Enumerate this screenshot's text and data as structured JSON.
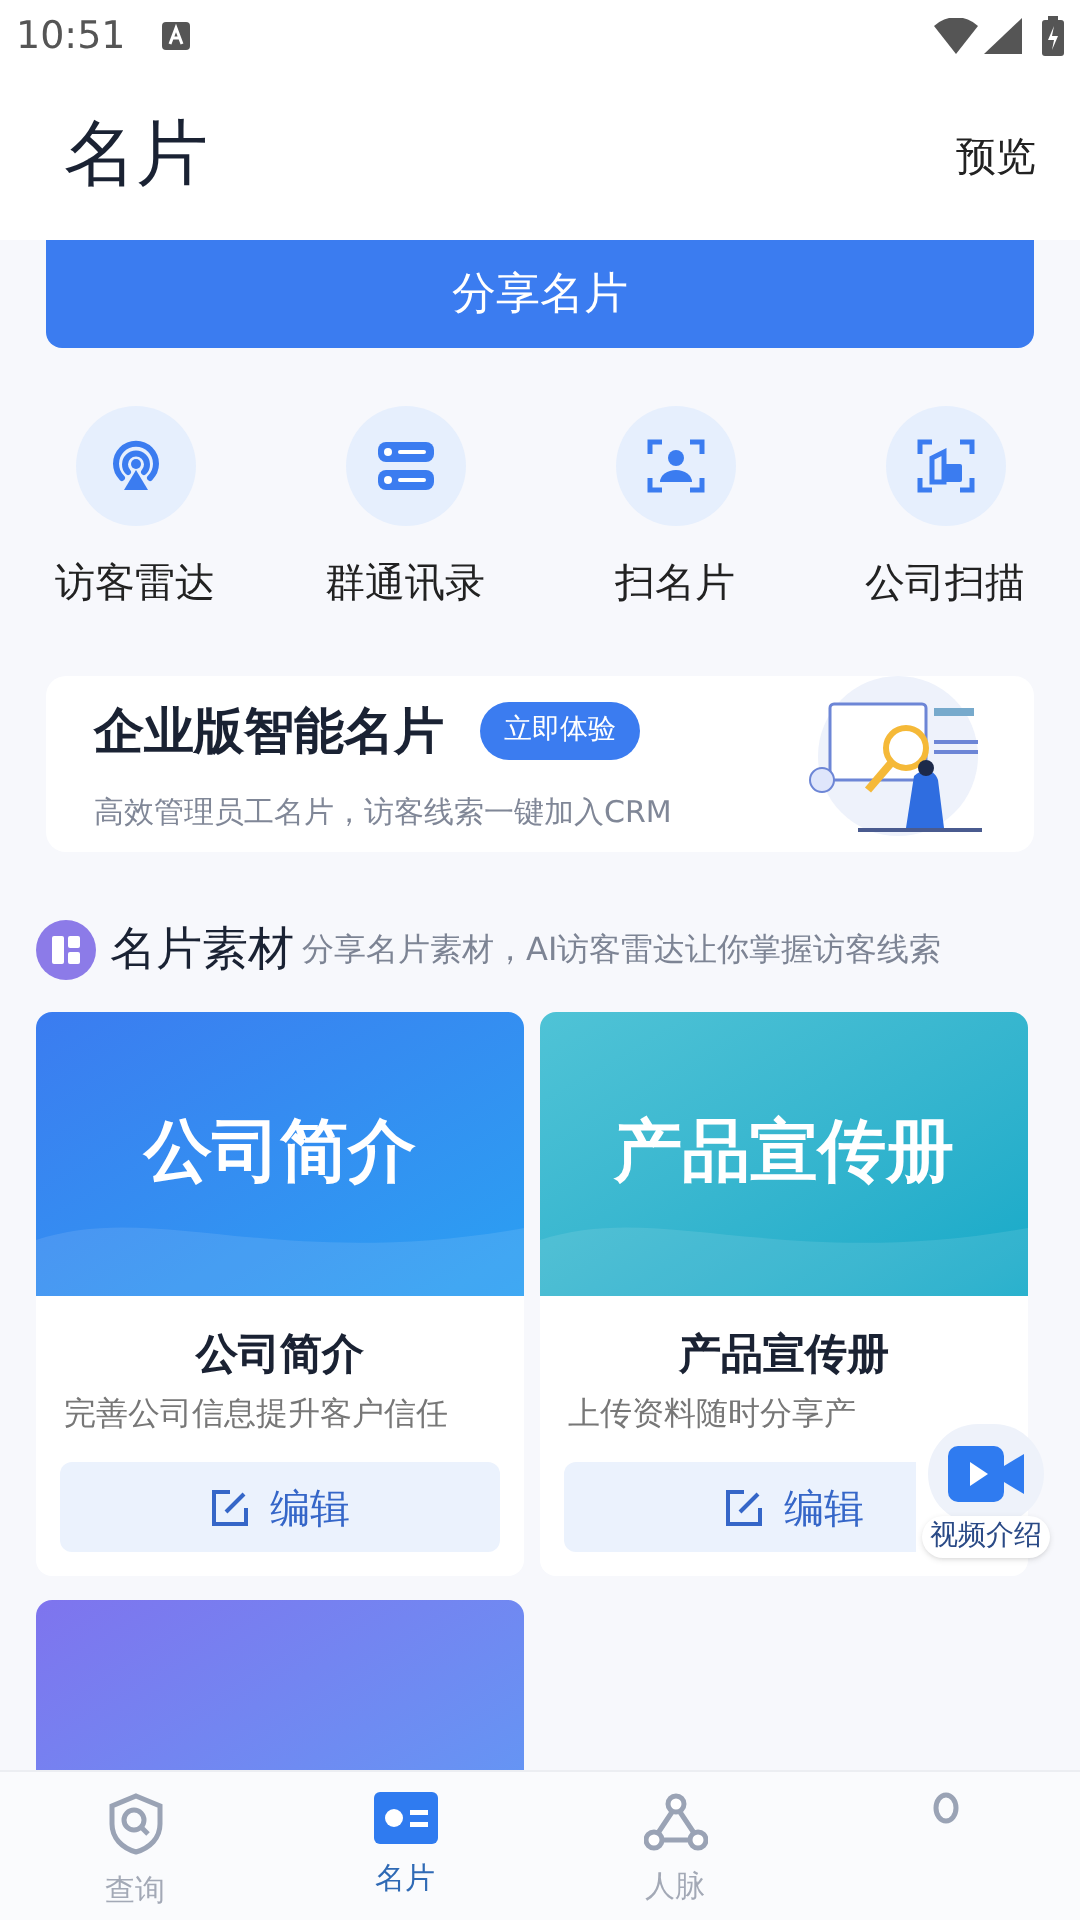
{
  "status_bar": {
    "time": "10:51"
  },
  "header": {
    "title": "名片",
    "action": "预览"
  },
  "share_button": "分享名片",
  "shortcuts": [
    {
      "label": "访客雷达"
    },
    {
      "label": "群通讯录"
    },
    {
      "label": "扫名片"
    },
    {
      "label": "公司扫描"
    }
  ],
  "promo": {
    "title": "企业版智能名片",
    "badge": "立即体验",
    "subtitle": "高效管理员工名片，访客线索一键加入CRM"
  },
  "materials": {
    "title": "名片素材",
    "subtitle": "分享名片素材，AI访客雷达让你掌握访客线索",
    "cards": [
      {
        "kind": "full",
        "banner": "公司简介",
        "title": "公司简介",
        "subtitle": "完善公司信息提升客户信任",
        "button": "编辑"
      },
      {
        "kind": "full",
        "banner": "产品宣传册",
        "title": "产品宣传册",
        "subtitle": "上传资料随时分享产",
        "button": "编辑"
      },
      {
        "kind": "banner"
      }
    ]
  },
  "floating_button": {
    "label": "视频介绍"
  },
  "tab_bar": [
    {
      "label": "查询",
      "selected": false
    },
    {
      "label": "名片",
      "selected": true
    },
    {
      "label": "人脉",
      "selected": false
    },
    {
      "selected": false
    }
  ]
}
